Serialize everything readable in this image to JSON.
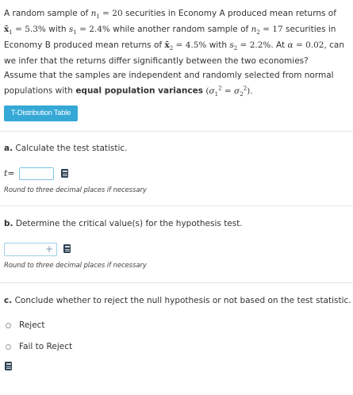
{
  "question": {
    "intro_1": "A random sample of",
    "n1_sym": "n",
    "n1_sub": "1",
    "eq": "=",
    "n1_val": "20",
    "intro_2": "securities in Economy A produced mean returns of",
    "xbar1_sym": "x̄",
    "xbar1_sub": "1",
    "xbar1_val": "5.3%",
    "with_1": "with",
    "s1_sym": "s",
    "s1_sub": "1",
    "s1_val": "2.4%",
    "intro_3": "while another random sample of",
    "n2_sym": "n",
    "n2_sub": "2",
    "n2_val": "17",
    "intro_4": "securities in",
    "intro_5": "Economy B produced mean returns of",
    "xbar2_sym": "x̄",
    "xbar2_sub": "2",
    "xbar2_val": "4.5%",
    "with_2": "with",
    "s2_sym": "s",
    "s2_sub": "2",
    "s2_val": "2.2%.",
    "at": "At",
    "alpha_sym": "α",
    "alpha_val": "0.02,",
    "can": "can",
    "intro_6": "we infer that the returns differ significantly between the two economies?",
    "assume_1": "Assume that the samples are independent and randomly selected from normal",
    "assume_2": "populations with",
    "assume_bold": "equal population variances",
    "variance_expr_open": "(",
    "sigma": "σ",
    "sub1": "1",
    "sub2": "2",
    "sup": "2",
    "variance_expr_close": ")."
  },
  "table_button": "T-Distribution Table",
  "part_a": {
    "letter": "a.",
    "label": "Calculate the test statistic.",
    "t_sym": "t",
    "eq": "=",
    "hint": "Round to three decimal places if necessary"
  },
  "part_b": {
    "letter": "b.",
    "label": "Determine the critical value(s) for the hypothesis test.",
    "plus": "+",
    "hint": "Round to three decimal places if necessary"
  },
  "part_c": {
    "letter": "c.",
    "label": "Conclude whether to reject the null hypothesis or not based on the test statistic.",
    "options": [
      "Reject",
      "Fail to Reject"
    ]
  },
  "icons": {
    "calculator": "calculator-icon"
  },
  "colors": {
    "button_bg": "#35a8d6",
    "input_border": "#7cc4e6",
    "text": "#333333"
  }
}
